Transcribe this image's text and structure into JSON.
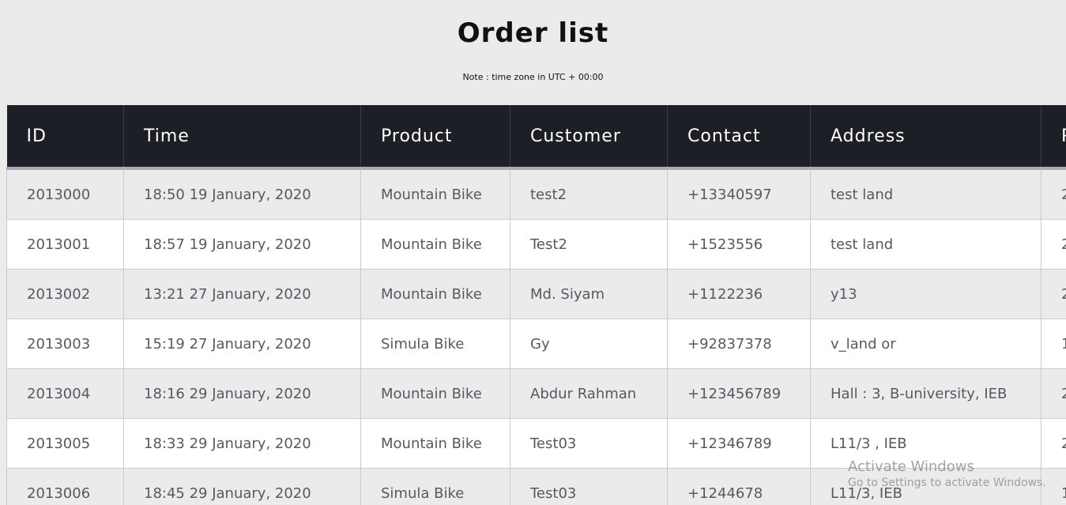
{
  "page": {
    "title": "Order list",
    "note": "Note : time zone in UTC + 00:00"
  },
  "table": {
    "columns": [
      "ID",
      "Time",
      "Product",
      "Customer",
      "Contact",
      "Address",
      "P"
    ],
    "rows": [
      [
        "2013000",
        "18:50 19 January, 2020",
        "Mountain Bike",
        "test2",
        "+13340597",
        "test land",
        "2"
      ],
      [
        "2013001",
        "18:57 19 January, 2020",
        "Mountain Bike",
        "Test2",
        "+1523556",
        "test land",
        "2"
      ],
      [
        "2013002",
        "13:21 27 January, 2020",
        "Mountain Bike",
        "Md. Siyam",
        "+1122236",
        "y13",
        "2"
      ],
      [
        "2013003",
        "15:19 27 January, 2020",
        "Simula Bike",
        "Gy",
        "+92837378",
        "v_land or",
        "1"
      ],
      [
        "2013004",
        "18:16 29 January, 2020",
        "Mountain Bike",
        "Abdur Rahman",
        "+123456789",
        "Hall : 3, B-university, IEB",
        "2"
      ],
      [
        "2013005",
        "18:33 29 January, 2020",
        "Mountain Bike",
        "Test03",
        "+12346789",
        "L11/3 , IEB",
        "2"
      ],
      [
        "2013006",
        "18:45 29 January, 2020",
        "Simula Bike",
        "Test03",
        "+1244678",
        "L11/3, IEB",
        "1"
      ]
    ]
  },
  "watermark": {
    "title": "Activate Windows",
    "subtitle": "Go to Settings to activate Windows."
  }
}
